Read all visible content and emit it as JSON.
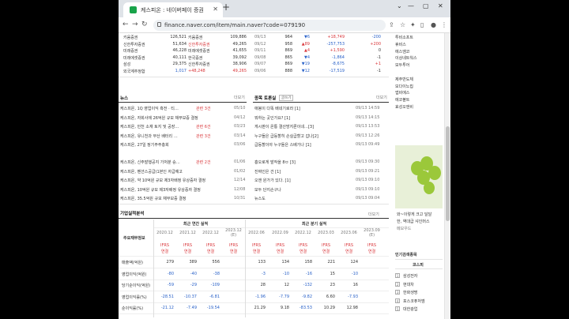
{
  "browser": {
    "tab_title": "케스피온 : 네이버페이 증권",
    "url": "finance.naver.com/item/main.naver?code=079190"
  },
  "trade_rows": [
    {
      "a": "키움증권",
      "b": "126,521",
      "c": "키움증권",
      "d": "109,886"
    },
    {
      "a": "신한투자증권",
      "b": "51,634",
      "c": "신한투자증권",
      "d": "49,265",
      "c_cls": "red"
    },
    {
      "a": "미래증권",
      "b": "46,228",
      "c": "미래에셋증권",
      "d": "41,655"
    },
    {
      "a": "미래에셋증권",
      "b": "40,111",
      "c": "한국증권",
      "d": "39,092"
    },
    {
      "a": "삼성",
      "b": "29,375",
      "c": "신한투자증권",
      "d": "38,906"
    },
    {
      "a": "외국계추정합",
      "b": "1,017",
      "b_cls": "blue",
      "c": "+48,248",
      "c_cls": "red",
      "d": "49,265",
      "d_cls": "red"
    }
  ],
  "investor_rows": [
    {
      "date": "09/13",
      "price": "964",
      "chg": "▼6",
      "chg_cls": "blue",
      "inst": "+18,749",
      "inst_cls": "red",
      "frn": "-200",
      "frn_cls": "blue"
    },
    {
      "date": "09/12",
      "price": "958",
      "chg": "▲89",
      "chg_cls": "red",
      "inst": "-257,753",
      "inst_cls": "blue",
      "frn": "+200",
      "frn_cls": "red"
    },
    {
      "date": "09/11",
      "price": "869",
      "chg": "▲4",
      "chg_cls": "red",
      "inst": "+1,590",
      "inst_cls": "red",
      "frn": "0"
    },
    {
      "date": "09/08",
      "price": "865",
      "chg": "▼4",
      "chg_cls": "blue",
      "inst": "-1,864",
      "inst_cls": "blue",
      "frn": "-1"
    },
    {
      "date": "09/07",
      "price": "869",
      "chg": "▼19",
      "chg_cls": "blue",
      "inst": "-8,675",
      "inst_cls": "blue",
      "frn": "+1",
      "frn_cls": "red"
    },
    {
      "date": "09/06",
      "price": "888",
      "chg": "▼12",
      "chg_cls": "blue",
      "inst": "-17,519",
      "inst_cls": "blue",
      "frn": "-1"
    }
  ],
  "more_label": "더보기",
  "news": {
    "title": "뉴스",
    "items": [
      {
        "t": "케스피온, 1Q 영업이익 흑전 · 티…",
        "badge": "관련 3건",
        "d": "05/10"
      },
      {
        "t": "케스피온, 자회사에 26억원 규모 채무보증 결정",
        "d": "04/12"
      },
      {
        "t": "케스피온, 민천 소재 토지 및 공장…",
        "badge": "관련 6건",
        "d": "03/23"
      },
      {
        "t": "케스피온, 유니천과 부산 배터리 …",
        "badge": "관련 3건",
        "d": "03/14"
      },
      {
        "t": "케스피온, 27일 정기주주총회",
        "d": "03/06"
      },
      {
        "t": "케스피온, 신주발행공지 가처분 승…",
        "badge": "관련 2건",
        "d": "01/06"
      },
      {
        "t": "케스피온, 펜션스공급(1본인 자급예고",
        "d": "01/02"
      },
      {
        "t": "케스피온, 약 10억원 규모 제3자배정 유상증자 결정",
        "d": "12/14"
      },
      {
        "t": "케스피온, 10억원 규모 제3자배정 유상증자 결정",
        "d": "12/08"
      },
      {
        "t": "케스피온, 35.5억원 규모 채무보증 결정",
        "d": "10/31"
      }
    ]
  },
  "board": {
    "title": "종목 토론실",
    "write_label": "글쓰기",
    "items": [
      {
        "t": "애봉이 다똑 배네기로라 [1]",
        "d": "09/13 14:59"
      },
      {
        "t": "뭐하는 곳인가요? [1]",
        "d": "09/13 14:15"
      },
      {
        "t": "게시판이 온통 결산방지론이네…[3]",
        "d": "09/13 13:53"
      },
      {
        "t": "누구들은 급등할히 손실급할고 갑나[2]",
        "d": "09/13 12:26"
      },
      {
        "t": "급등할이야 누구들은 스베가나 [1]",
        "d": "09/13 09:49"
      },
      {
        "t": "흥오로게 발작을 8ㅂ [3]",
        "d": "09/13 09:30"
      },
      {
        "t": "진짜인은 건 [1]",
        "d": "09/13 09:21"
      },
      {
        "t": "오앤 원가가 있다. [1]",
        "d": "09/13 09:10"
      },
      {
        "t": "모두 단지손구나",
        "d": "09/13 09:10"
      },
      {
        "t": "뉴스도",
        "d": "09/13 09:04"
      }
    ]
  },
  "fin": {
    "title": "기업실적분석",
    "more": "더보기",
    "annual": "최근 연간 실적",
    "quarter": "최근 분기 실적",
    "label_hdr": "주요재무정보",
    "years": [
      "2020.12",
      "2021.12",
      "2022.12",
      "2023.12"
    ],
    "years_est": "(E)",
    "quarters": [
      "2022.06",
      "2022.09",
      "2022.12",
      "2023.03",
      "2023.06",
      "2023.09"
    ],
    "quarter_est": "(E)",
    "std_a": "IFRS",
    "std_b": "연결",
    "rows": [
      {
        "n": "매출액(억원)",
        "v": [
          "279",
          "389",
          "556",
          "",
          "133",
          "134",
          "158",
          "221",
          "124",
          ""
        ]
      },
      {
        "n": "영업이익(억원)",
        "v": [
          "-80",
          "-40",
          "-38",
          "",
          "-3",
          "-10",
          "-16",
          "15",
          "-10",
          ""
        ]
      },
      {
        "n": "당기순이익(억원)",
        "v": [
          "-59",
          "-29",
          "-109",
          "",
          "28",
          "12",
          "-132",
          "23",
          "16",
          ""
        ]
      },
      {
        "n": "영업이익률(%)",
        "v": [
          "-28.51",
          "-10.37",
          "-6.81",
          "",
          "-1.96",
          "-7.79",
          "-9.82",
          "6.60",
          "-7.93",
          ""
        ]
      },
      {
        "n": "순이익률(%)",
        "v": [
          "-21.12",
          "-7.49",
          "-19.54",
          "",
          "21.29",
          "9.18",
          "-83.53",
          "10.29",
          "12.98",
          ""
        ]
      }
    ]
  },
  "sidebar": {
    "links": [
      "투비소프트",
      "휴비스",
      "에스엠코",
      "이상네트웍스",
      "모두투어",
      "",
      "제주반도체",
      "모다이노칩",
      "앱비에스",
      "에코볼트",
      "효성오앤비"
    ],
    "ad_text": "와~이렇게 크고 달달",
    "ad_sub": "한, 역대급 샤인머스",
    "ad_brand": "메모우드",
    "popular_title": "인기검색종목",
    "kospi": "코스피",
    "popular": [
      "삼성전자",
      "현대차",
      "한화생명",
      "포스코퓨처엠",
      "대한광업"
    ]
  }
}
